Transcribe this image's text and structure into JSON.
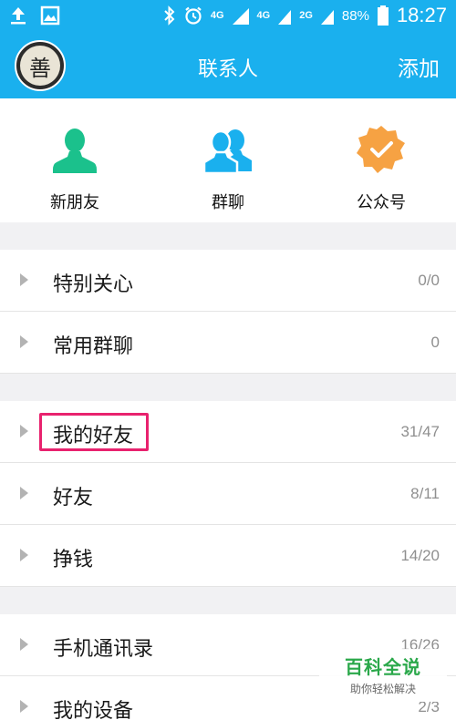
{
  "status_bar": {
    "network_4g_a": "4G",
    "network_4g_b": "4G",
    "network_2g": "2G",
    "battery_percent": "88%",
    "time": "18:27"
  },
  "header": {
    "avatar_glyph": "善",
    "title": "联系人",
    "add_label": "添加",
    "background_color": "#1ab0ee"
  },
  "quick_actions": [
    {
      "label": "新朋友",
      "icon": "single-person-icon",
      "color": "#1bc18c"
    },
    {
      "label": "群聊",
      "icon": "group-people-icon",
      "color": "#1ab0ee"
    },
    {
      "label": "公众号",
      "icon": "verified-badge-icon",
      "color": "#f6a243"
    }
  ],
  "groups": [
    {
      "label": "特别关心",
      "count": "0/0"
    },
    {
      "label": "常用群聊",
      "count": "0"
    },
    {
      "label": "我的好友",
      "count": "31/47"
    },
    {
      "label": "好友",
      "count": "8/11"
    },
    {
      "label": "挣钱",
      "count": "14/20"
    },
    {
      "label": "手机通讯录",
      "count": "16/26"
    },
    {
      "label": "我的设备",
      "count": "2/3"
    }
  ],
  "watermark": {
    "title": "百科全说",
    "subtitle": "助你轻松解决"
  }
}
